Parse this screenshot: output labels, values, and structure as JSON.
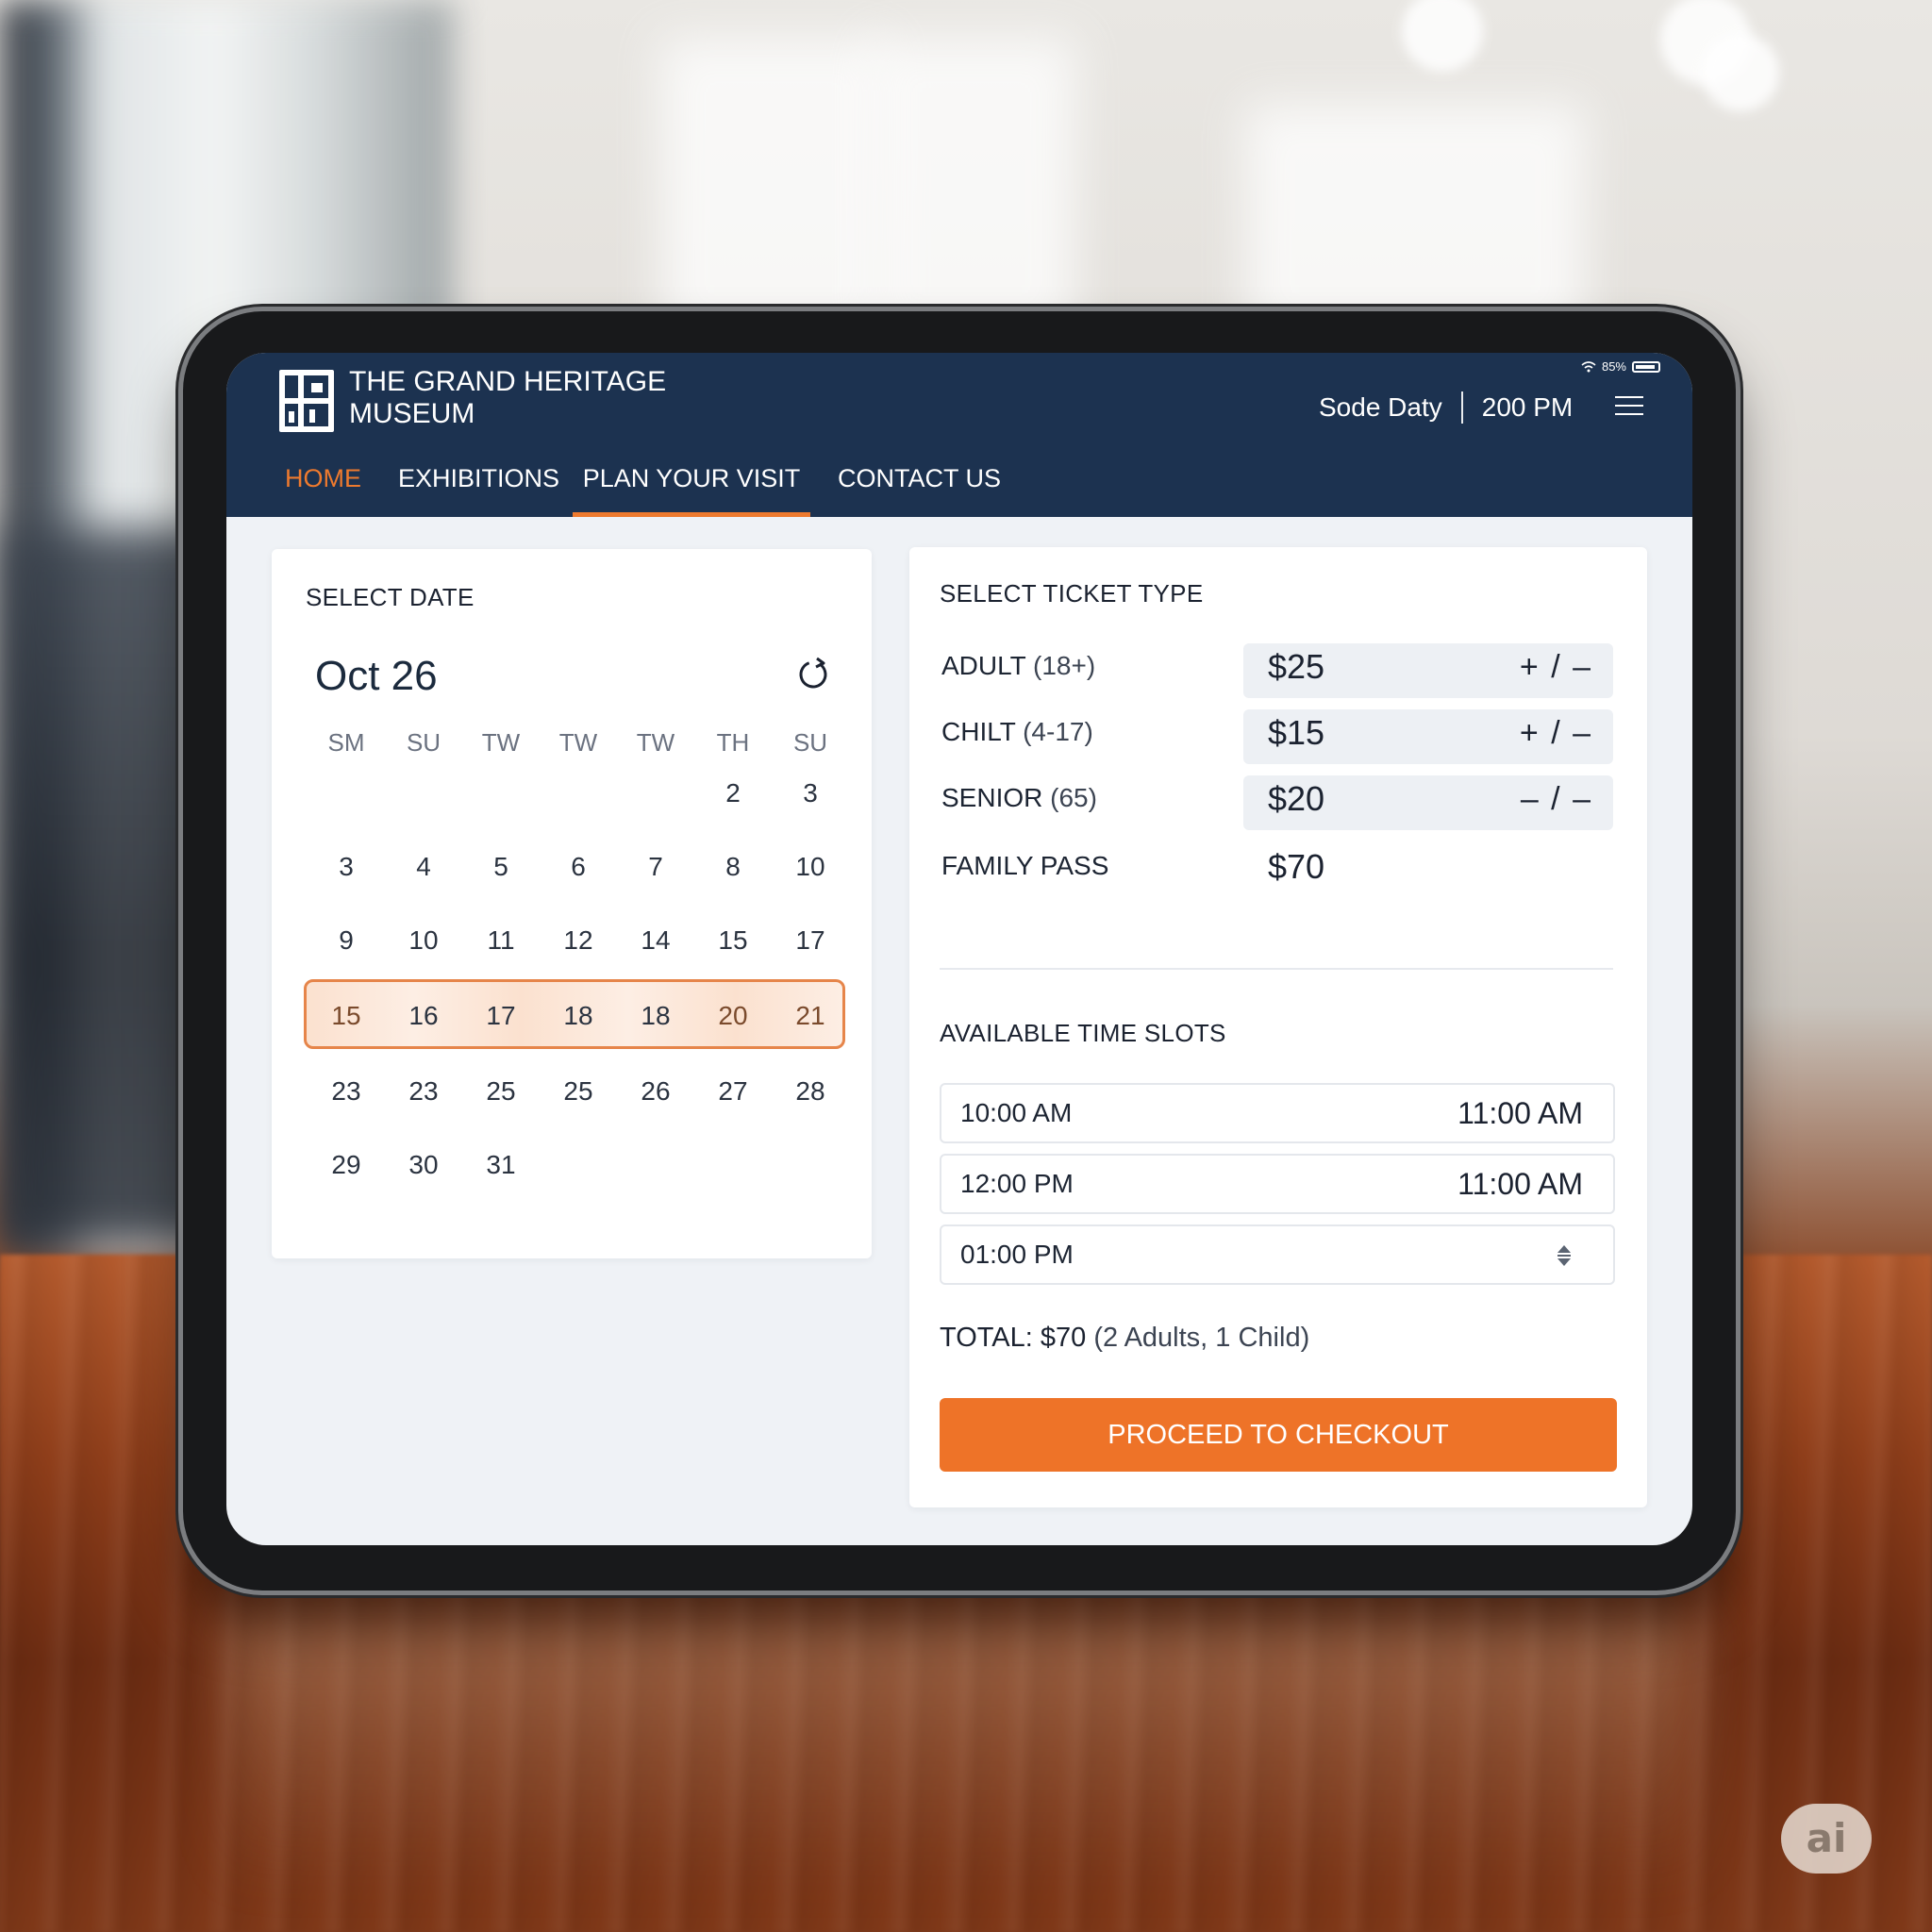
{
  "app": {
    "name": "THE GRAND HERITAGE MUSEUM",
    "status": {
      "battery": "85%"
    },
    "header_info": {
      "label": "Sode Daty",
      "time": "200 PM"
    }
  },
  "nav": {
    "items": [
      {
        "label": "HOME",
        "state": "accent"
      },
      {
        "label": "EXHIBITIONS",
        "state": "normal"
      },
      {
        "label": "PLAN YOUR VISIT",
        "state": "active"
      },
      {
        "label": "CONTACT US",
        "state": "normal"
      }
    ]
  },
  "calendar": {
    "title": "SELECT DATE",
    "month_label": "Oct 26",
    "weekdays": [
      "SM",
      "SU",
      "TW",
      "TW",
      "TW",
      "TH",
      "SU"
    ],
    "weeks": [
      [
        "",
        "",
        "",
        "",
        "",
        "2",
        "3"
      ],
      [
        "3",
        "4",
        "5",
        "6",
        "7",
        "8",
        "10"
      ],
      [
        "9",
        "10",
        "11",
        "12",
        "14",
        "15",
        "17"
      ],
      [
        "15",
        "16",
        "17",
        "18",
        "18",
        "20",
        "21"
      ],
      [
        "23",
        "23",
        "25",
        "25",
        "26",
        "27",
        "28"
      ],
      [
        "29",
        "30",
        "31",
        "",
        "",
        "",
        ""
      ]
    ],
    "selected_week_index": 3
  },
  "tickets": {
    "title": "SELECT TICKET TYPE",
    "items": [
      {
        "name": "ADULT",
        "qualifier": "(18+)",
        "price": "$25",
        "control": "+ / –"
      },
      {
        "name": "CHILT",
        "qualifier": "(4-17)",
        "price": "$15",
        "control": "+ / –"
      },
      {
        "name": "SENIOR",
        "qualifier": "(65)",
        "price": "$20",
        "control": "– / –"
      },
      {
        "name": "FAMILY PASS",
        "qualifier": "",
        "price": "$70",
        "control": ""
      }
    ]
  },
  "time_slots": {
    "title": "AVAILABLE TIME SLOTS",
    "items": [
      {
        "start": "10:00 AM",
        "end": "11:00 AM"
      },
      {
        "start": "12:00 PM",
        "end": "11:00 AM"
      },
      {
        "start": "01:00 PM",
        "end": ""
      }
    ]
  },
  "summary": {
    "total_label": "TOTAL: $70",
    "total_note": "(2 Adults, 1 Child)"
  },
  "checkout": {
    "label": "PROCEED TO CHECKOUT"
  },
  "badge": {
    "label": "ai"
  },
  "colors": {
    "header_bg": "#1c3250",
    "accent": "#ee7328",
    "highlight_bg": "#fbe1cf",
    "page_bg": "#eff2f6"
  }
}
